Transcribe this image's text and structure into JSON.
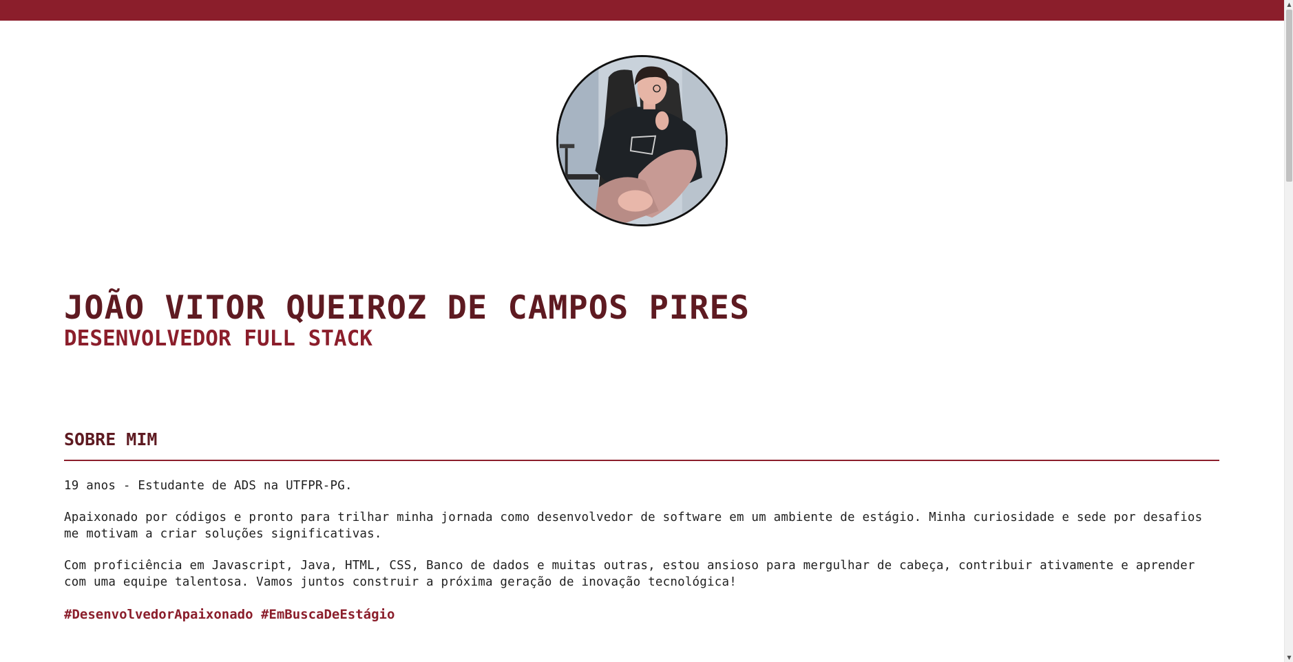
{
  "profile": {
    "name": "JOÃO VITOR QUEIROZ DE CAMPOS PIRES",
    "role": "DESENVOLVEDOR FULL STACK"
  },
  "about": {
    "title": "SOBRE MIM",
    "paragraphs": [
      "19 anos - Estudante de ADS na UTFPR-PG.",
      "Apaixonado por códigos e pronto para trilhar minha jornada como desenvolvedor de software em um ambiente de estágio. Minha curiosidade e sede por desafios me motivam a criar soluções significativas.",
      "Com proficiência em Javascript, Java, HTML, CSS, Banco de dados e muitas outras, estou ansioso para mergulhar de cabeça, contribuir ativamente e aprender com uma equipe talentosa. Vamos juntos construir a próxima geração de inovação tecnológica!"
    ],
    "hashtags": "#DesenvolvedorApaixonado #EmBuscaDeEstágio"
  },
  "colors": {
    "accent": "#8b1e2b",
    "heading": "#5e1a21"
  },
  "scrollbar": {
    "up_icon": "▲",
    "down_icon": "▼"
  }
}
